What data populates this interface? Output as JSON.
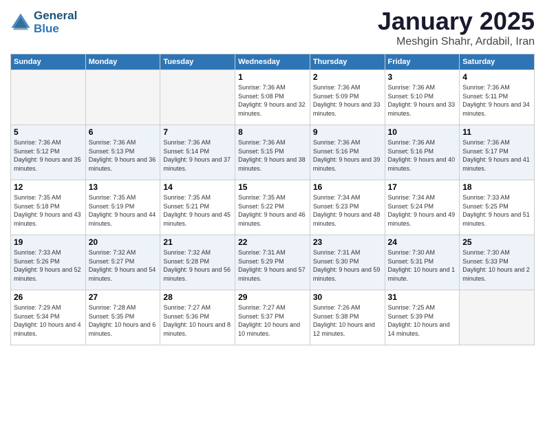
{
  "header": {
    "logo_line1": "General",
    "logo_line2": "Blue",
    "month": "January 2025",
    "location": "Meshgin Shahr, Ardabil, Iran"
  },
  "weekdays": [
    "Sunday",
    "Monday",
    "Tuesday",
    "Wednesday",
    "Thursday",
    "Friday",
    "Saturday"
  ],
  "weeks": [
    [
      {
        "day": "",
        "info": ""
      },
      {
        "day": "",
        "info": ""
      },
      {
        "day": "",
        "info": ""
      },
      {
        "day": "1",
        "info": "Sunrise: 7:36 AM\nSunset: 5:08 PM\nDaylight: 9 hours and 32 minutes."
      },
      {
        "day": "2",
        "info": "Sunrise: 7:36 AM\nSunset: 5:09 PM\nDaylight: 9 hours and 33 minutes."
      },
      {
        "day": "3",
        "info": "Sunrise: 7:36 AM\nSunset: 5:10 PM\nDaylight: 9 hours and 33 minutes."
      },
      {
        "day": "4",
        "info": "Sunrise: 7:36 AM\nSunset: 5:11 PM\nDaylight: 9 hours and 34 minutes."
      }
    ],
    [
      {
        "day": "5",
        "info": "Sunrise: 7:36 AM\nSunset: 5:12 PM\nDaylight: 9 hours and 35 minutes."
      },
      {
        "day": "6",
        "info": "Sunrise: 7:36 AM\nSunset: 5:13 PM\nDaylight: 9 hours and 36 minutes."
      },
      {
        "day": "7",
        "info": "Sunrise: 7:36 AM\nSunset: 5:14 PM\nDaylight: 9 hours and 37 minutes."
      },
      {
        "day": "8",
        "info": "Sunrise: 7:36 AM\nSunset: 5:15 PM\nDaylight: 9 hours and 38 minutes."
      },
      {
        "day": "9",
        "info": "Sunrise: 7:36 AM\nSunset: 5:16 PM\nDaylight: 9 hours and 39 minutes."
      },
      {
        "day": "10",
        "info": "Sunrise: 7:36 AM\nSunset: 5:16 PM\nDaylight: 9 hours and 40 minutes."
      },
      {
        "day": "11",
        "info": "Sunrise: 7:36 AM\nSunset: 5:17 PM\nDaylight: 9 hours and 41 minutes."
      }
    ],
    [
      {
        "day": "12",
        "info": "Sunrise: 7:35 AM\nSunset: 5:18 PM\nDaylight: 9 hours and 43 minutes."
      },
      {
        "day": "13",
        "info": "Sunrise: 7:35 AM\nSunset: 5:19 PM\nDaylight: 9 hours and 44 minutes."
      },
      {
        "day": "14",
        "info": "Sunrise: 7:35 AM\nSunset: 5:21 PM\nDaylight: 9 hours and 45 minutes."
      },
      {
        "day": "15",
        "info": "Sunrise: 7:35 AM\nSunset: 5:22 PM\nDaylight: 9 hours and 46 minutes."
      },
      {
        "day": "16",
        "info": "Sunrise: 7:34 AM\nSunset: 5:23 PM\nDaylight: 9 hours and 48 minutes."
      },
      {
        "day": "17",
        "info": "Sunrise: 7:34 AM\nSunset: 5:24 PM\nDaylight: 9 hours and 49 minutes."
      },
      {
        "day": "18",
        "info": "Sunrise: 7:33 AM\nSunset: 5:25 PM\nDaylight: 9 hours and 51 minutes."
      }
    ],
    [
      {
        "day": "19",
        "info": "Sunrise: 7:33 AM\nSunset: 5:26 PM\nDaylight: 9 hours and 52 minutes."
      },
      {
        "day": "20",
        "info": "Sunrise: 7:32 AM\nSunset: 5:27 PM\nDaylight: 9 hours and 54 minutes."
      },
      {
        "day": "21",
        "info": "Sunrise: 7:32 AM\nSunset: 5:28 PM\nDaylight: 9 hours and 56 minutes."
      },
      {
        "day": "22",
        "info": "Sunrise: 7:31 AM\nSunset: 5:29 PM\nDaylight: 9 hours and 57 minutes."
      },
      {
        "day": "23",
        "info": "Sunrise: 7:31 AM\nSunset: 5:30 PM\nDaylight: 9 hours and 59 minutes."
      },
      {
        "day": "24",
        "info": "Sunrise: 7:30 AM\nSunset: 5:31 PM\nDaylight: 10 hours and 1 minute."
      },
      {
        "day": "25",
        "info": "Sunrise: 7:30 AM\nSunset: 5:33 PM\nDaylight: 10 hours and 2 minutes."
      }
    ],
    [
      {
        "day": "26",
        "info": "Sunrise: 7:29 AM\nSunset: 5:34 PM\nDaylight: 10 hours and 4 minutes."
      },
      {
        "day": "27",
        "info": "Sunrise: 7:28 AM\nSunset: 5:35 PM\nDaylight: 10 hours and 6 minutes."
      },
      {
        "day": "28",
        "info": "Sunrise: 7:27 AM\nSunset: 5:36 PM\nDaylight: 10 hours and 8 minutes."
      },
      {
        "day": "29",
        "info": "Sunrise: 7:27 AM\nSunset: 5:37 PM\nDaylight: 10 hours and 10 minutes."
      },
      {
        "day": "30",
        "info": "Sunrise: 7:26 AM\nSunset: 5:38 PM\nDaylight: 10 hours and 12 minutes."
      },
      {
        "day": "31",
        "info": "Sunrise: 7:25 AM\nSunset: 5:39 PM\nDaylight: 10 hours and 14 minutes."
      },
      {
        "day": "",
        "info": ""
      }
    ]
  ]
}
